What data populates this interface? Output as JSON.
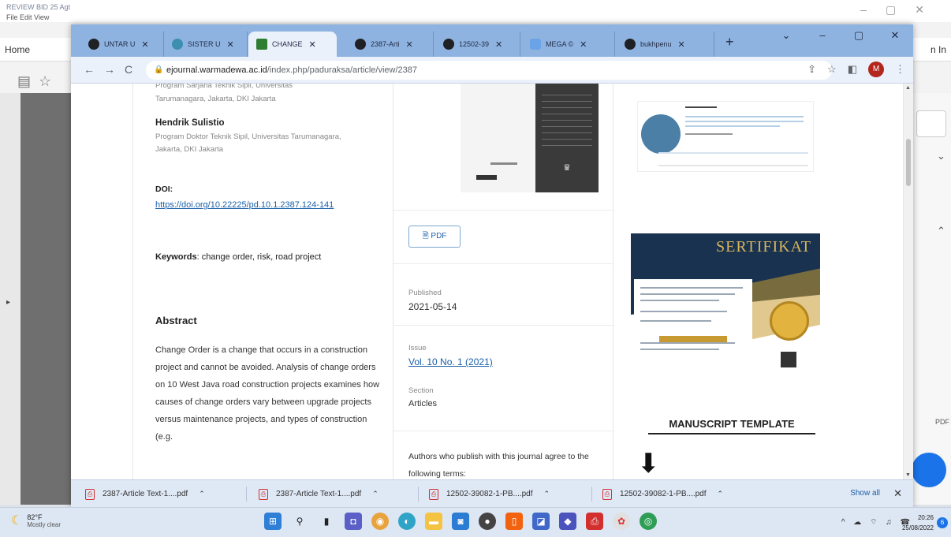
{
  "background_app": {
    "title": "REVIEW BID 25 Agt",
    "menu": "File  Edit  View",
    "home_label": "Home",
    "signin_label": "n In",
    "pdf_label": "PDF"
  },
  "browser": {
    "tabs": [
      {
        "label": "UNTAR U",
        "icon": "globe-icon"
      },
      {
        "label": "SISTER U",
        "icon": "teal-icon"
      },
      {
        "label": "CHANGE",
        "icon": "journal-icon"
      },
      {
        "label": "2387-Arti",
        "icon": "globe-icon"
      },
      {
        "label": "12502-39",
        "icon": "globe-icon"
      },
      {
        "label": "MEGA ©",
        "icon": "cloud-icon"
      },
      {
        "label": "bukhpenu",
        "icon": "globe-icon"
      }
    ],
    "url_host": "ejournal.warmadewa.ac.id",
    "url_path": "/index.php/paduraksa/article/view/2387",
    "avatar_letter": "M"
  },
  "article": {
    "prev_author_lines": [
      "Program Sarjana Teknik Sipil, Universitas",
      "Tarumanagara, Jakarta, DKI Jakarta"
    ],
    "author_name": "Hendrik Sulistio",
    "author_affiliation": "Program Doktor Teknik Sipil, Universitas Tarumanagara, Jakarta, DKI Jakarta",
    "doi_label": "DOI:",
    "doi_link": "https://doi.org/10.22225/pd.10.1.2387.124-141",
    "keywords_label": "Keywords",
    "keywords": ": change order, risk, road project",
    "abstract_heading": "Abstract",
    "abstract_text": "Change Order is a change that occurs in a construction project and cannot be avoided. Analysis of change orders on 10 West Java road construction projects examines how causes of change orders vary between upgrade projects versus maintenance projects, and types of construction (e.g."
  },
  "sidebar": {
    "pdf_button": "PDF",
    "published_label": "Published",
    "published_value": "2021-05-14",
    "issue_label": "Issue",
    "issue_value": "Vol. 10 No. 1 (2021)",
    "section_label": "Section",
    "section_value": "Articles",
    "license_text": "Authors who publish with this journal agree to the following terms:"
  },
  "right_col": {
    "certificate_title": "SERTIFIKAT",
    "manuscript_heading": "MANUSCRIPT TEMPLATE"
  },
  "downloads": {
    "items": [
      "2387-Article Text-1....pdf",
      "2387-Article Text-1....pdf",
      "12502-39082-1-PB....pdf",
      "12502-39082-1-PB....pdf"
    ],
    "show_all": "Show all"
  },
  "taskbar": {
    "temperature": "82°F",
    "weather": "Mostly clear",
    "time": "20:26",
    "date": "25/08/2022",
    "notifications": "6"
  }
}
